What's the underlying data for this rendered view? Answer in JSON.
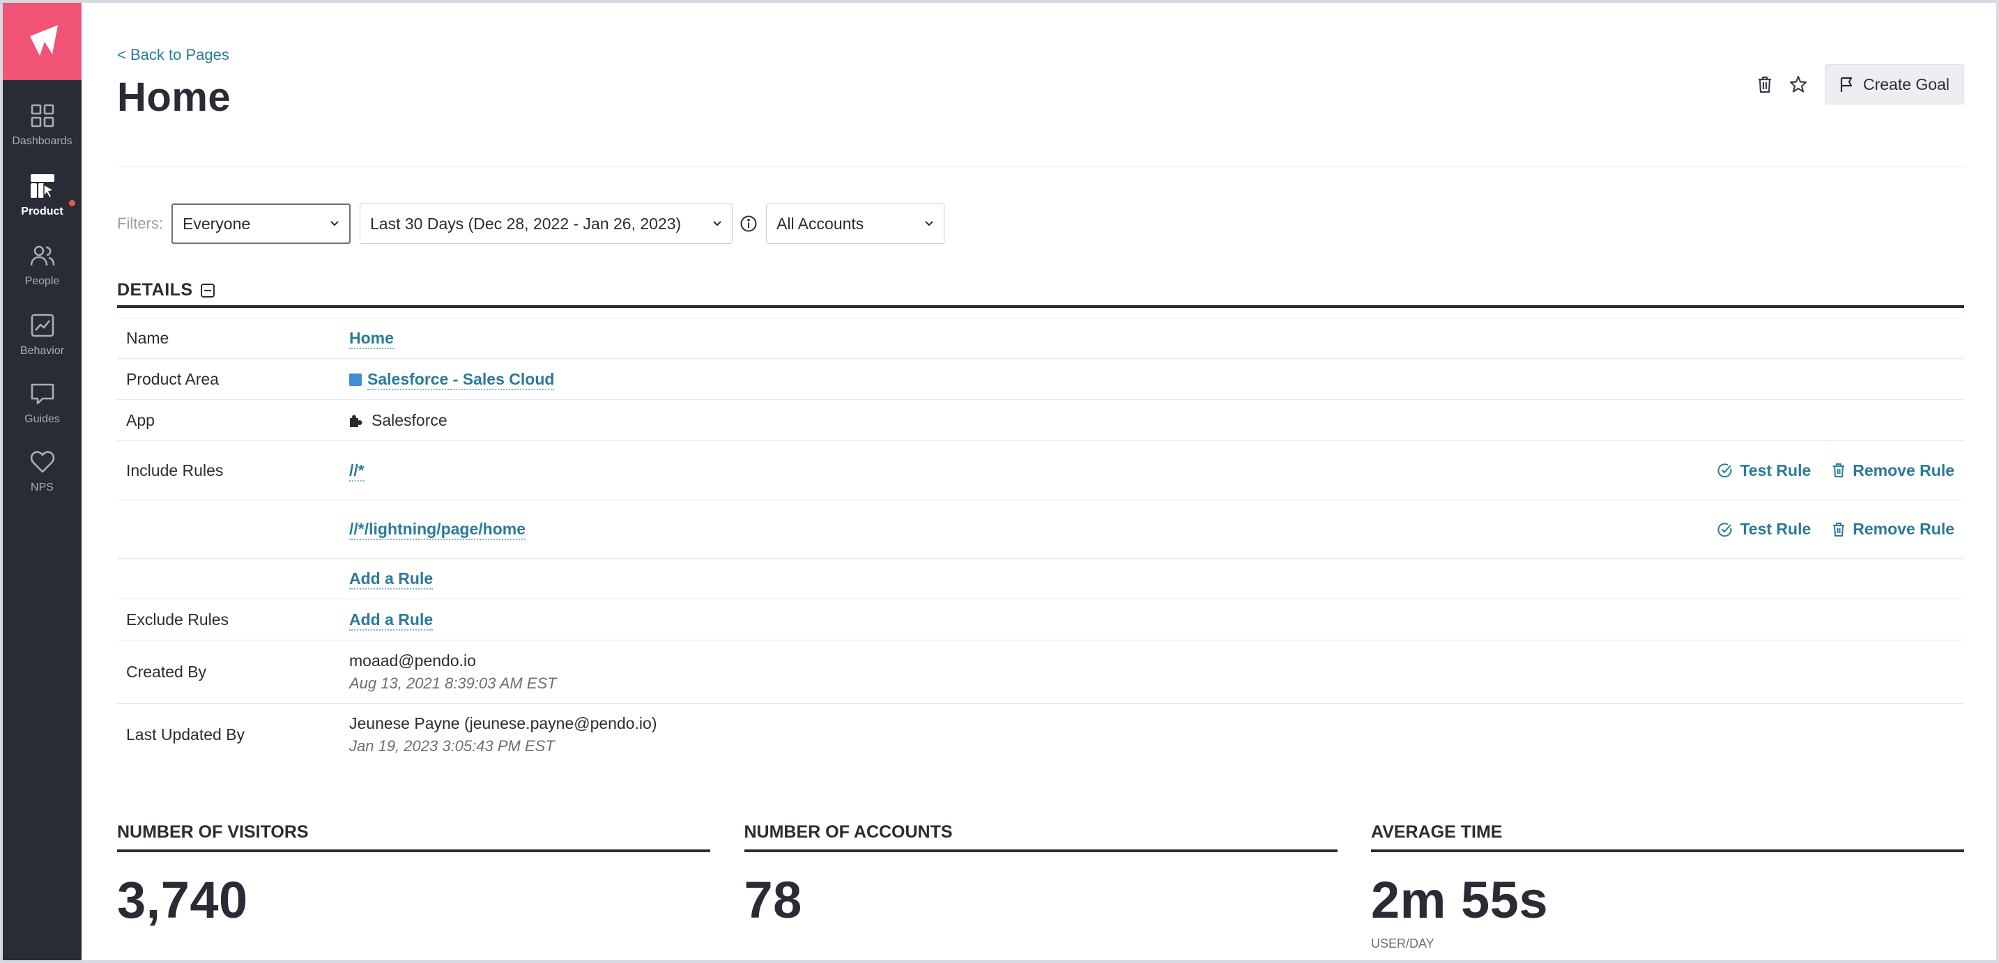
{
  "sidebar": {
    "items": [
      {
        "label": "Dashboards",
        "icon": "grid-icon",
        "active": false
      },
      {
        "label": "Product",
        "icon": "product-icon",
        "active": true
      },
      {
        "label": "People",
        "icon": "people-icon",
        "active": false
      },
      {
        "label": "Behavior",
        "icon": "chart-icon",
        "active": false
      },
      {
        "label": "Guides",
        "icon": "guide-icon",
        "active": false
      },
      {
        "label": "NPS",
        "icon": "heart-icon",
        "active": false
      }
    ]
  },
  "header": {
    "back_link": "< Back to Pages",
    "title": "Home",
    "create_goal_label": "Create Goal"
  },
  "filters": {
    "label": "Filters:",
    "segment": "Everyone",
    "date_range": "Last 30 Days (Dec 28, 2022 - Jan 26, 2023)",
    "accounts": "All Accounts"
  },
  "details": {
    "title": "DETAILS",
    "name_label": "Name",
    "name_value": "Home",
    "product_area_label": "Product Area",
    "product_area_value": "Salesforce - Sales Cloud",
    "product_area_color": "#3d8fd6",
    "app_label": "App",
    "app_value": "Salesforce",
    "include_rules_label": "Include Rules",
    "include_rules": [
      "//*",
      "//*/lightning/page/home"
    ],
    "test_rule_label": "Test Rule",
    "remove_rule_label": "Remove Rule",
    "add_rule_label": "Add a Rule",
    "exclude_rules_label": "Exclude Rules",
    "created_by_label": "Created By",
    "created_by_value": "moaad@pendo.io",
    "created_at": "Aug 13, 2021 8:39:03 AM EST",
    "updated_by_label": "Last Updated By",
    "updated_by_value": "Jeunese Payne (jeunese.payne@pendo.io)",
    "updated_at": "Jan 19, 2023 3:05:43 PM EST"
  },
  "metrics": {
    "visitors_title": "NUMBER OF VISITORS",
    "visitors_value": "3,740",
    "accounts_title": "NUMBER OF ACCOUNTS",
    "accounts_value": "78",
    "avg_time_title": "AVERAGE TIME",
    "avg_time_value": "2m 55s",
    "avg_time_unit": "USER/DAY"
  },
  "colors": {
    "brand": "#f05376",
    "sidebar": "#2a2c35",
    "link": "#2b7a99"
  }
}
